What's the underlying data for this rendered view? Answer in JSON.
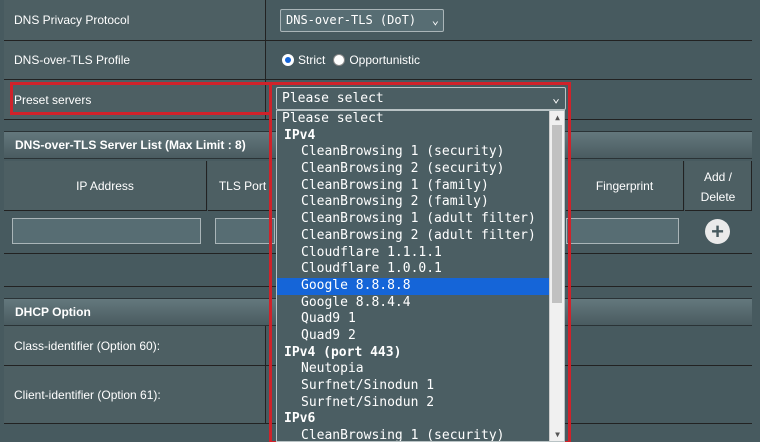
{
  "privacy_protocol": {
    "label": "DNS Privacy Protocol",
    "value": "DNS-over-TLS (DoT)"
  },
  "dot_profile": {
    "label": "DNS-over-TLS Profile",
    "strict": "Strict",
    "opportunistic": "Opportunistic"
  },
  "preset": {
    "label": "Preset servers",
    "value": "Please select"
  },
  "server_list": {
    "title": "DNS-over-TLS Server List (Max Limit : 8)",
    "headers": {
      "ip": "IP Address",
      "port": "TLS Port",
      "fingerprint": "Fingerprint",
      "add_delete": "Add / Delete"
    }
  },
  "dhcp": {
    "title": "DHCP Option",
    "class_id": "Class-identifier (Option 60):",
    "client_id": "Client-identifier (Option 61):"
  },
  "dropdown": {
    "options": [
      {
        "text": "Please select",
        "kind": "plain"
      },
      {
        "text": "IPv4",
        "kind": "group"
      },
      {
        "text": "CleanBrowsing 1 (security)",
        "kind": "indent"
      },
      {
        "text": "CleanBrowsing 2 (security)",
        "kind": "indent"
      },
      {
        "text": "CleanBrowsing 1 (family)",
        "kind": "indent"
      },
      {
        "text": "CleanBrowsing 2 (family)",
        "kind": "indent"
      },
      {
        "text": "CleanBrowsing 1 (adult filter)",
        "kind": "indent"
      },
      {
        "text": "CleanBrowsing 2 (adult filter)",
        "kind": "indent"
      },
      {
        "text": "Cloudflare 1.1.1.1",
        "kind": "indent"
      },
      {
        "text": "Cloudflare 1.0.0.1",
        "kind": "indent"
      },
      {
        "text": "Google 8.8.8.8",
        "kind": "indent",
        "selected": true
      },
      {
        "text": "Google 8.8.4.4",
        "kind": "indent"
      },
      {
        "text": "Quad9 1",
        "kind": "indent"
      },
      {
        "text": "Quad9 2",
        "kind": "indent"
      },
      {
        "text": "IPv4 (port 443)",
        "kind": "group"
      },
      {
        "text": "Neutopia",
        "kind": "indent"
      },
      {
        "text": "Surfnet/Sinodun 1",
        "kind": "indent"
      },
      {
        "text": "Surfnet/Sinodun 2",
        "kind": "indent"
      },
      {
        "text": "IPv6",
        "kind": "group"
      },
      {
        "text": "CleanBrowsing 1 (security)",
        "kind": "indent"
      }
    ]
  },
  "colors": {
    "highlight": "#d0222a",
    "selection": "#1565d8"
  }
}
